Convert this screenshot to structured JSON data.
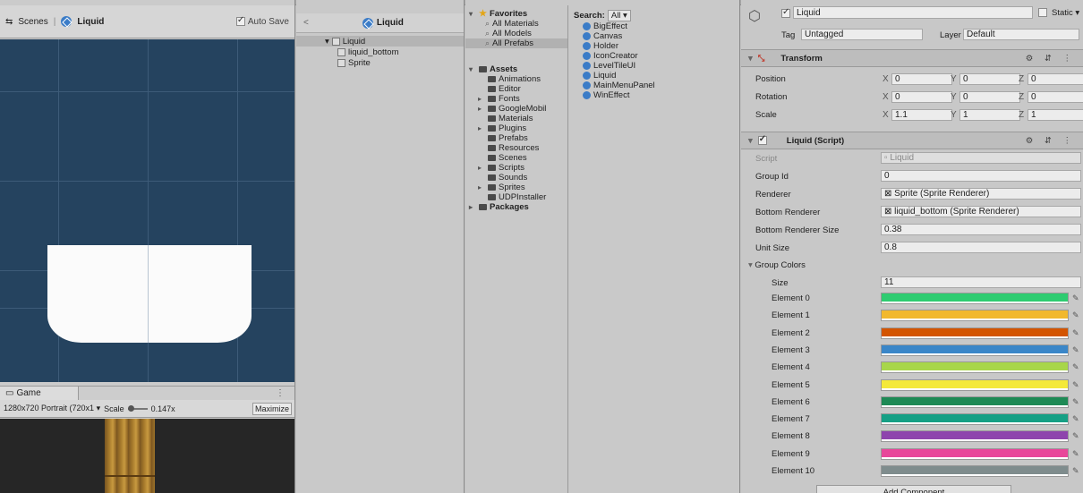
{
  "scene": {
    "tab_label": "Scenes",
    "breadcrumb": "Liquid",
    "auto_save": "Auto Save"
  },
  "game": {
    "tab_label": "Game",
    "menu": "⋮",
    "resolution": "1280x720 Portrait (720x1 ▾",
    "scale_label": "Scale",
    "scale_value": "0.147x",
    "maximize": "Maximize"
  },
  "hierarchy": {
    "back": "<",
    "title": "Liquid",
    "items": [
      {
        "label": "Liquid",
        "expander": "▾"
      },
      {
        "label": "liquid_bottom"
      },
      {
        "label": "Sprite"
      }
    ]
  },
  "project": {
    "favorites": {
      "label": "Favorites",
      "items": [
        "All Materials",
        "All Models",
        "All Prefabs"
      ]
    },
    "assets": {
      "label": "Assets",
      "items": [
        {
          "label": "Animations",
          "arrow": ""
        },
        {
          "label": "Editor",
          "arrow": ""
        },
        {
          "label": "Fonts",
          "arrow": "▸"
        },
        {
          "label": "GoogleMobil",
          "arrow": "▸"
        },
        {
          "label": "Materials",
          "arrow": ""
        },
        {
          "label": "Plugins",
          "arrow": "▸"
        },
        {
          "label": "Prefabs",
          "arrow": ""
        },
        {
          "label": "Resources",
          "arrow": ""
        },
        {
          "label": "Scenes",
          "arrow": ""
        },
        {
          "label": "Scripts",
          "arrow": "▸"
        },
        {
          "label": "Sounds",
          "arrow": ""
        },
        {
          "label": "Sprites",
          "arrow": "▸"
        },
        {
          "label": "UDPInstaller",
          "arrow": ""
        }
      ]
    },
    "packages": "Packages",
    "search_label": "Search:",
    "search_scope": "All ▾",
    "results": [
      "BigEffect",
      "Canvas",
      "Holder",
      "IconCreator",
      "LevelTileUI",
      "Liquid",
      "MainMenuPanel",
      "WinEffect"
    ]
  },
  "inspector": {
    "object_name": "Liquid",
    "static_label": "Static ▾",
    "tag_label": "Tag",
    "tag_value": "Untagged",
    "layer_label": "Layer",
    "layer_value": "Default",
    "transform": {
      "title": "Transform",
      "icons": "⚙ ⇵ ⋮",
      "rows": [
        {
          "label": "Position",
          "x": "0",
          "y": "0",
          "z": "0"
        },
        {
          "label": "Rotation",
          "x": "0",
          "y": "0",
          "z": "0"
        },
        {
          "label": "Scale",
          "x": "1.1",
          "y": "1",
          "z": "1"
        }
      ]
    },
    "script": {
      "title": "Liquid (Script)",
      "icons": "⚙ ⇵ ⋮",
      "script_label": "Script",
      "script_value": "▫ Liquid",
      "group_id_label": "Group Id",
      "group_id": "0",
      "renderer_label": "Renderer",
      "renderer": "⊠ Sprite (Sprite Renderer)",
      "bottom_renderer_label": "Bottom Renderer",
      "bottom_renderer": "⊠ liquid_bottom (Sprite Renderer)",
      "bottom_renderer_size_label": "Bottom Renderer Size",
      "bottom_renderer_size": "0.38",
      "unit_size_label": "Unit Size",
      "unit_size": "0.8",
      "group_colors_label": "Group Colors",
      "size_label": "Size",
      "size": "11",
      "elements": [
        {
          "label": "Element 0",
          "color": "#2ecc71"
        },
        {
          "label": "Element 1",
          "color": "#f1b82d"
        },
        {
          "label": "Element 2",
          "color": "#d35400"
        },
        {
          "label": "Element 3",
          "color": "#3a86c8"
        },
        {
          "label": "Element 4",
          "color": "#a8d64a"
        },
        {
          "label": "Element 5",
          "color": "#f4e93a"
        },
        {
          "label": "Element 6",
          "color": "#1e8a55"
        },
        {
          "label": "Element 7",
          "color": "#16a085"
        },
        {
          "label": "Element 8",
          "color": "#8e44ad"
        },
        {
          "label": "Element 9",
          "color": "#e8479a"
        },
        {
          "label": "Element 10",
          "color": "#7f8c8d"
        }
      ]
    },
    "add_component": "Add Component"
  }
}
